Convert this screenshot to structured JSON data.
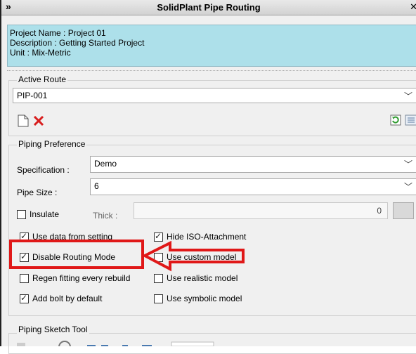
{
  "window": {
    "title": "SolidPlant Pipe Routing",
    "expand_glyph": "»",
    "pin_glyph": "✕"
  },
  "project": {
    "name_line": "Project Name : Project 01",
    "description_line": "Description : Getting Started Project",
    "unit_line": "Unit : Mix-Metric"
  },
  "active_route": {
    "group_label": "Active Route",
    "value": "PIP-001"
  },
  "piping_preference": {
    "group_label": "Piping Preference",
    "specification_label": "Specification :",
    "specification_value": "Demo",
    "pipe_size_label": "Pipe Size :",
    "pipe_size_value": "6",
    "insulate_label": "Insulate",
    "thick_label": "Thick :",
    "thick_value": "0",
    "checkboxes": {
      "use_data_from_setting": {
        "label": "Use data from setting",
        "checked": true
      },
      "hide_iso_attachment": {
        "label": "Hide ISO-Attachment",
        "checked": true
      },
      "disable_routing_mode": {
        "label": "Disable Routing Mode",
        "checked": true
      },
      "use_custom_model": {
        "label": "Use custom model",
        "checked": false
      },
      "regen_fitting": {
        "label": "Regen fitting every rebuild",
        "checked": false
      },
      "use_realistic_model": {
        "label": "Use realistic model",
        "checked": false
      },
      "add_bolt": {
        "label": "Add bolt by default",
        "checked": true
      },
      "use_symbolic_model": {
        "label": "Use symbolic model",
        "checked": false
      }
    }
  },
  "piping_sketch_tool": {
    "group_label": "Piping Sketch Tool"
  },
  "colors": {
    "info_bg": "#ade0ea",
    "highlight": "#e01818",
    "delete_icon": "#d81e1e",
    "refresh_icon": "#2e9a2e"
  }
}
